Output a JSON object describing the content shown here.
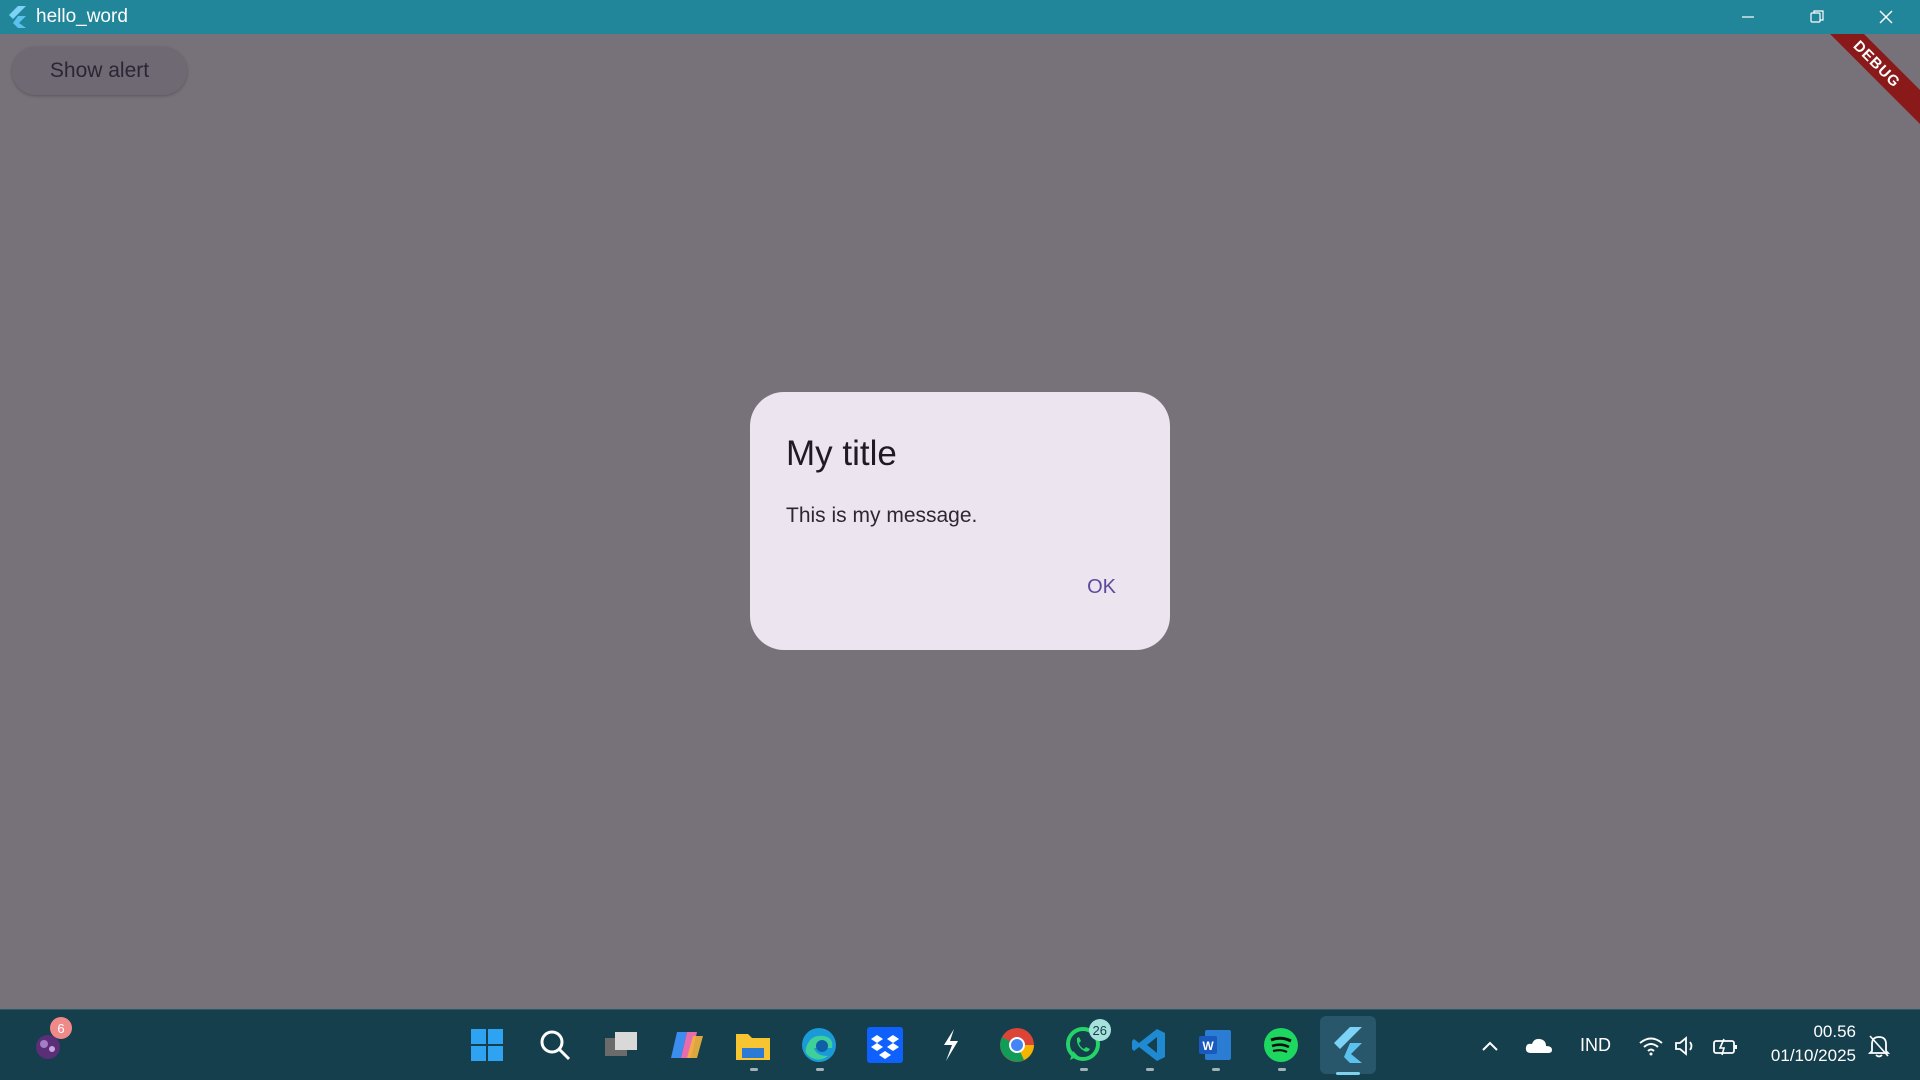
{
  "window": {
    "title": "hello_word",
    "controls": [
      "minimize",
      "restore",
      "close"
    ]
  },
  "app": {
    "show_alert_label": "Show alert",
    "debug_banner": "DEBUG"
  },
  "dialog": {
    "title": "My title",
    "message": "This is my message.",
    "ok_label": "OK"
  },
  "taskbar": {
    "widget_badge": "6",
    "pinned": [
      {
        "name": "start",
        "icon": "windows-start-icon"
      },
      {
        "name": "search",
        "icon": "search-icon"
      },
      {
        "name": "task-view",
        "icon": "task-view-icon"
      },
      {
        "name": "copilot",
        "icon": "copilot-icon"
      },
      {
        "name": "file-explorer",
        "icon": "folder-icon"
      },
      {
        "name": "edge",
        "icon": "edge-icon"
      },
      {
        "name": "dropbox",
        "icon": "dropbox-icon"
      },
      {
        "name": "app",
        "icon": "bolt-icon"
      },
      {
        "name": "chrome",
        "icon": "chrome-icon"
      },
      {
        "name": "whatsapp",
        "icon": "whatsapp-icon",
        "badge": "26"
      },
      {
        "name": "vscode",
        "icon": "vscode-icon"
      },
      {
        "name": "word",
        "icon": "word-icon"
      },
      {
        "name": "spotify",
        "icon": "spotify-icon"
      },
      {
        "name": "flutter",
        "icon": "flutter-icon"
      }
    ],
    "tray": {
      "language": "IND",
      "time": "00.56",
      "date": "01/10/2025"
    }
  },
  "colors": {
    "titlebar": "#22869a",
    "scrim": "#77727a",
    "dialog_bg": "#ece4ef",
    "accent": "#5e4a9c",
    "taskbar": "#153f4d"
  }
}
